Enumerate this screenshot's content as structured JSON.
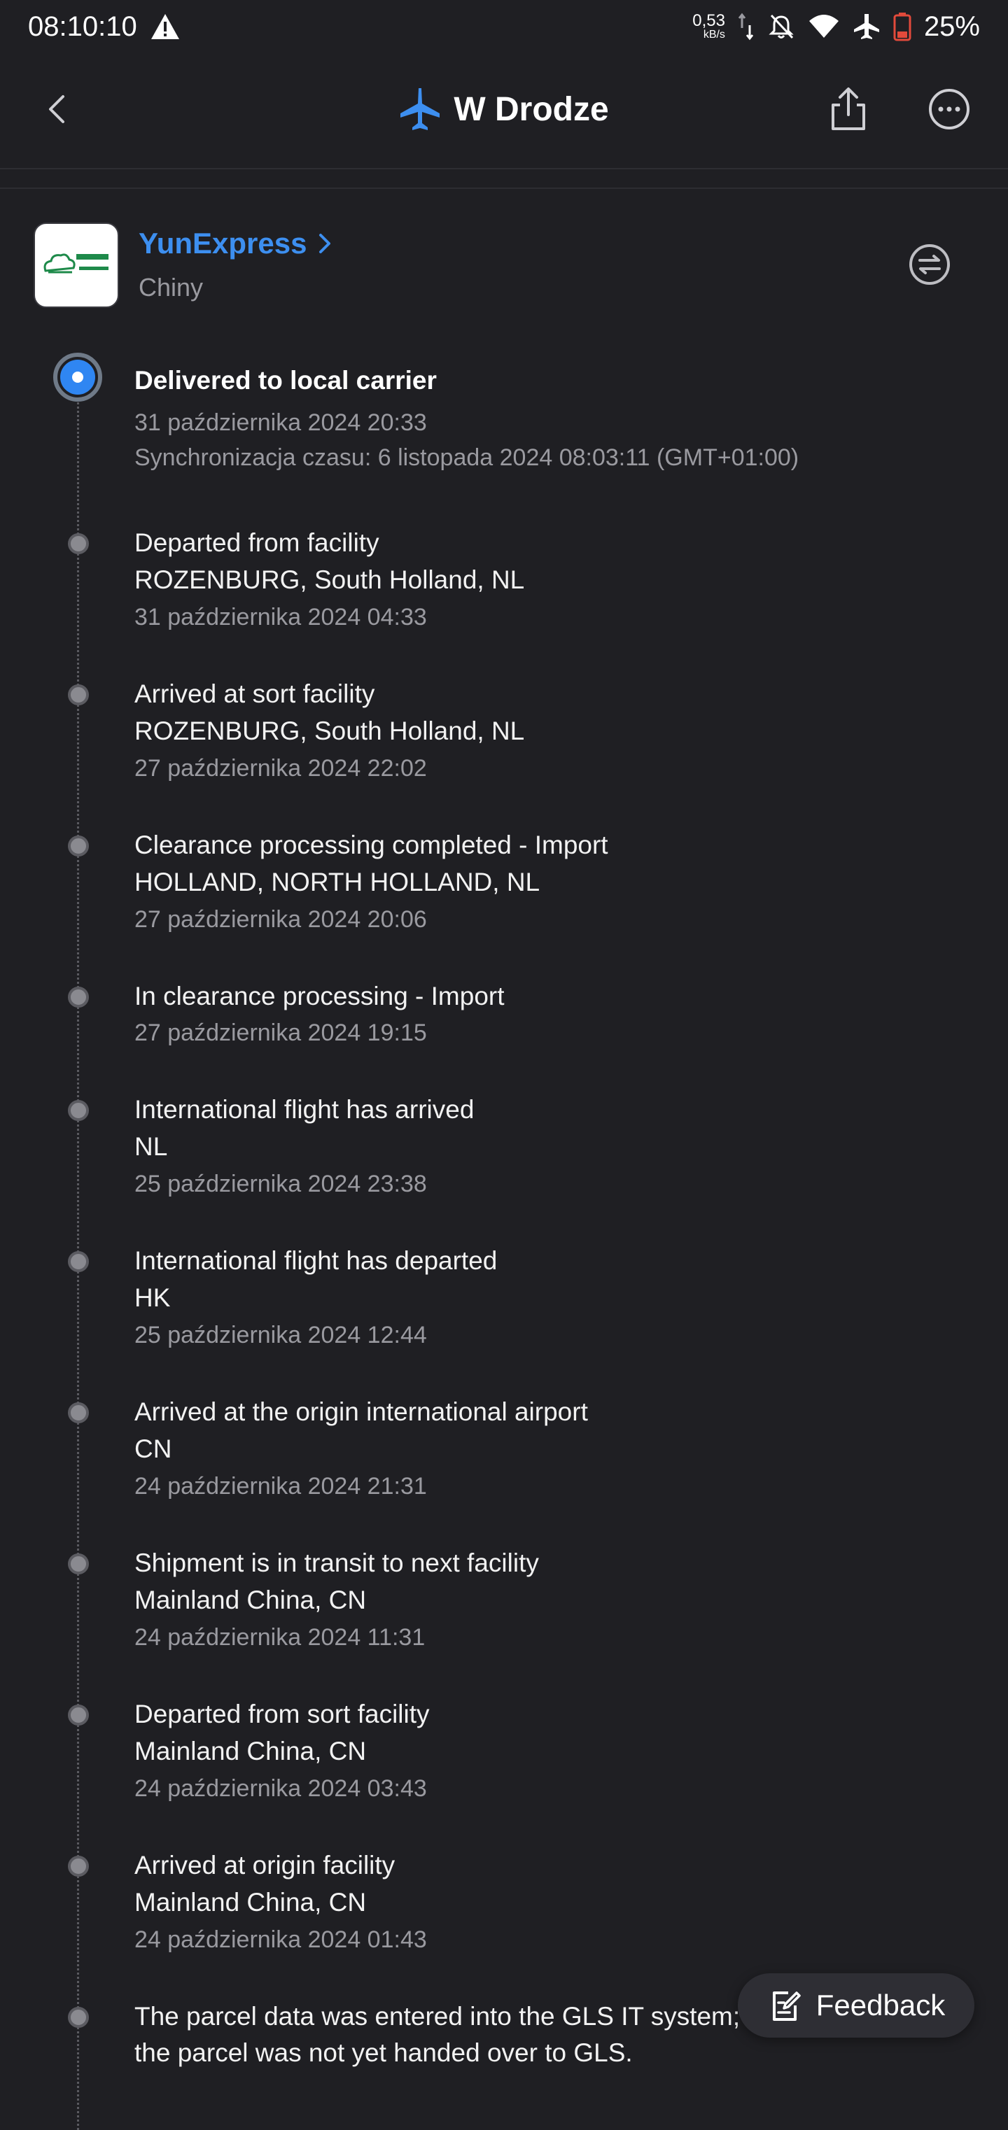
{
  "status_bar": {
    "time": "08:10:10",
    "net_speed": "0,53",
    "net_unit": "kB/s",
    "battery": "25%"
  },
  "header": {
    "title": "W Drodze",
    "accent_color": "#3d8ff0",
    "icons": [
      "back-arrow-icon",
      "airplane-icon",
      "share-icon",
      "more-icon"
    ]
  },
  "carrier": {
    "name": "YunExpress",
    "country": "Chiny"
  },
  "events": [
    {
      "status": "Delivered to local carrier",
      "location": "",
      "time": "31 października 2024 20:33",
      "sync": "Synchronizacja czasu: 6 listopada 2024 08:03:11 (GMT+01:00)",
      "active": true
    },
    {
      "status": "Departed from facility",
      "location": "ROZENBURG, South Holland, NL",
      "time": "31 października 2024 04:33"
    },
    {
      "status": "Arrived at sort facility",
      "location": "ROZENBURG, South Holland, NL",
      "time": "27 października 2024 22:02"
    },
    {
      "status": "Clearance processing completed - Import",
      "location": "HOLLAND, NORTH HOLLAND, NL",
      "time": "27 października 2024 20:06"
    },
    {
      "status": "In clearance processing - Import",
      "location": "",
      "time": "27 października 2024 19:15"
    },
    {
      "status": "International flight has arrived",
      "location": "NL",
      "time": "25 października 2024 23:38"
    },
    {
      "status": "International flight has departed",
      "location": "HK",
      "time": "25 października 2024 12:44"
    },
    {
      "status": "Arrived at the origin international airport",
      "location": "CN",
      "time": "24 października 2024 21:31"
    },
    {
      "status": "Shipment is in transit to next facility",
      "location": "Mainland China, CN",
      "time": "24 października 2024 11:31"
    },
    {
      "status": "Departed from sort facility",
      "location": "Mainland China, CN",
      "time": "24 października 2024 03:43"
    },
    {
      "status": "Arrived at origin facility",
      "location": "Mainland China, CN",
      "time": "24 października 2024 01:43"
    },
    {
      "status": "The parcel data was entered into the GLS IT system; the parcel was not yet handed over to GLS.",
      "location": "",
      "time": ""
    }
  ],
  "feedback_label": "Feedback"
}
